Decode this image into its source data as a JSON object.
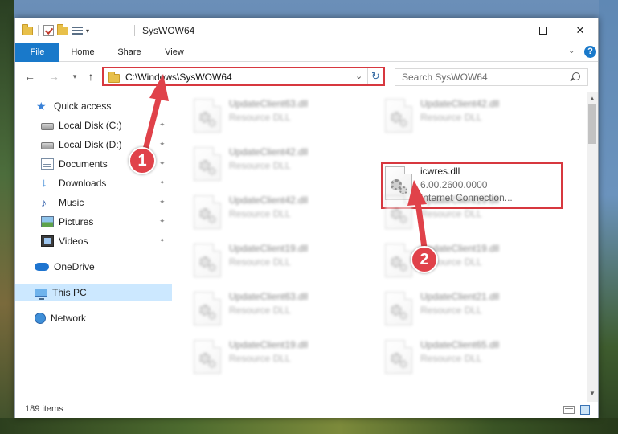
{
  "window": {
    "title": "SysWOW64"
  },
  "ribbon": {
    "tabs": [
      {
        "label": "File"
      },
      {
        "label": "Home"
      },
      {
        "label": "Share"
      },
      {
        "label": "View"
      }
    ],
    "help_label": "?"
  },
  "nav": {
    "address": "C:\\Windows\\SysWOW64",
    "search_placeholder": "Search SysWOW64"
  },
  "sidebar": {
    "items": [
      {
        "label": "Quick access",
        "icon": "star-icon"
      },
      {
        "label": "Local Disk (C:)",
        "icon": "disk-icon",
        "pinned": true
      },
      {
        "label": "Local Disk (D:)",
        "icon": "disk-icon",
        "pinned": true
      },
      {
        "label": "Documents",
        "icon": "document-icon",
        "pinned": true
      },
      {
        "label": "Downloads",
        "icon": "download-icon",
        "pinned": true
      },
      {
        "label": "Music",
        "icon": "music-icon",
        "pinned": true
      },
      {
        "label": "Pictures",
        "icon": "picture-icon",
        "pinned": true
      },
      {
        "label": "Videos",
        "icon": "video-icon",
        "pinned": true
      },
      {
        "label": "OneDrive",
        "icon": "cloud-icon"
      },
      {
        "label": "This PC",
        "icon": "computer-icon",
        "selected": true
      },
      {
        "label": "Network",
        "icon": "network-icon"
      }
    ]
  },
  "files": {
    "left_column": [
      {
        "name": "UpdateClient63.dll",
        "type": "Resource DLL"
      },
      {
        "name": "UpdateClient42.dll",
        "type": "Resource DLL"
      },
      {
        "name": "UpdateClient42.dll",
        "type": "Resource DLL"
      },
      {
        "name": "UpdateClient19.dll",
        "type": "Resource DLL"
      },
      {
        "name": "UpdateClient63.dll",
        "type": "Resource DLL"
      },
      {
        "name": "UpdateClient19.dll",
        "type": "Resource DLL"
      }
    ],
    "right_column": [
      {
        "name": "UpdateClient42.dll",
        "type": "Resource DLL"
      },
      {
        "name": "icwres.dll",
        "version": "6.00.2600.0000",
        "description": "Internet Connection..."
      },
      {
        "name": "UpdateClient19.dll",
        "type": "Resource DLL"
      },
      {
        "name": "UpdateClient19.dll",
        "type": "Resource DLL"
      },
      {
        "name": "UpdateClient21.dll",
        "type": "Resource DLL"
      },
      {
        "name": "UpdateClient65.dll",
        "type": "Resource DLL"
      }
    ]
  },
  "status": {
    "item_count": "189 items"
  },
  "annotations": {
    "step1": "1",
    "step2": "2",
    "color": "#e0424a"
  },
  "colors": {
    "accent": "#1979ca",
    "highlight_box": "#d7383f",
    "selection": "#cce8ff"
  }
}
